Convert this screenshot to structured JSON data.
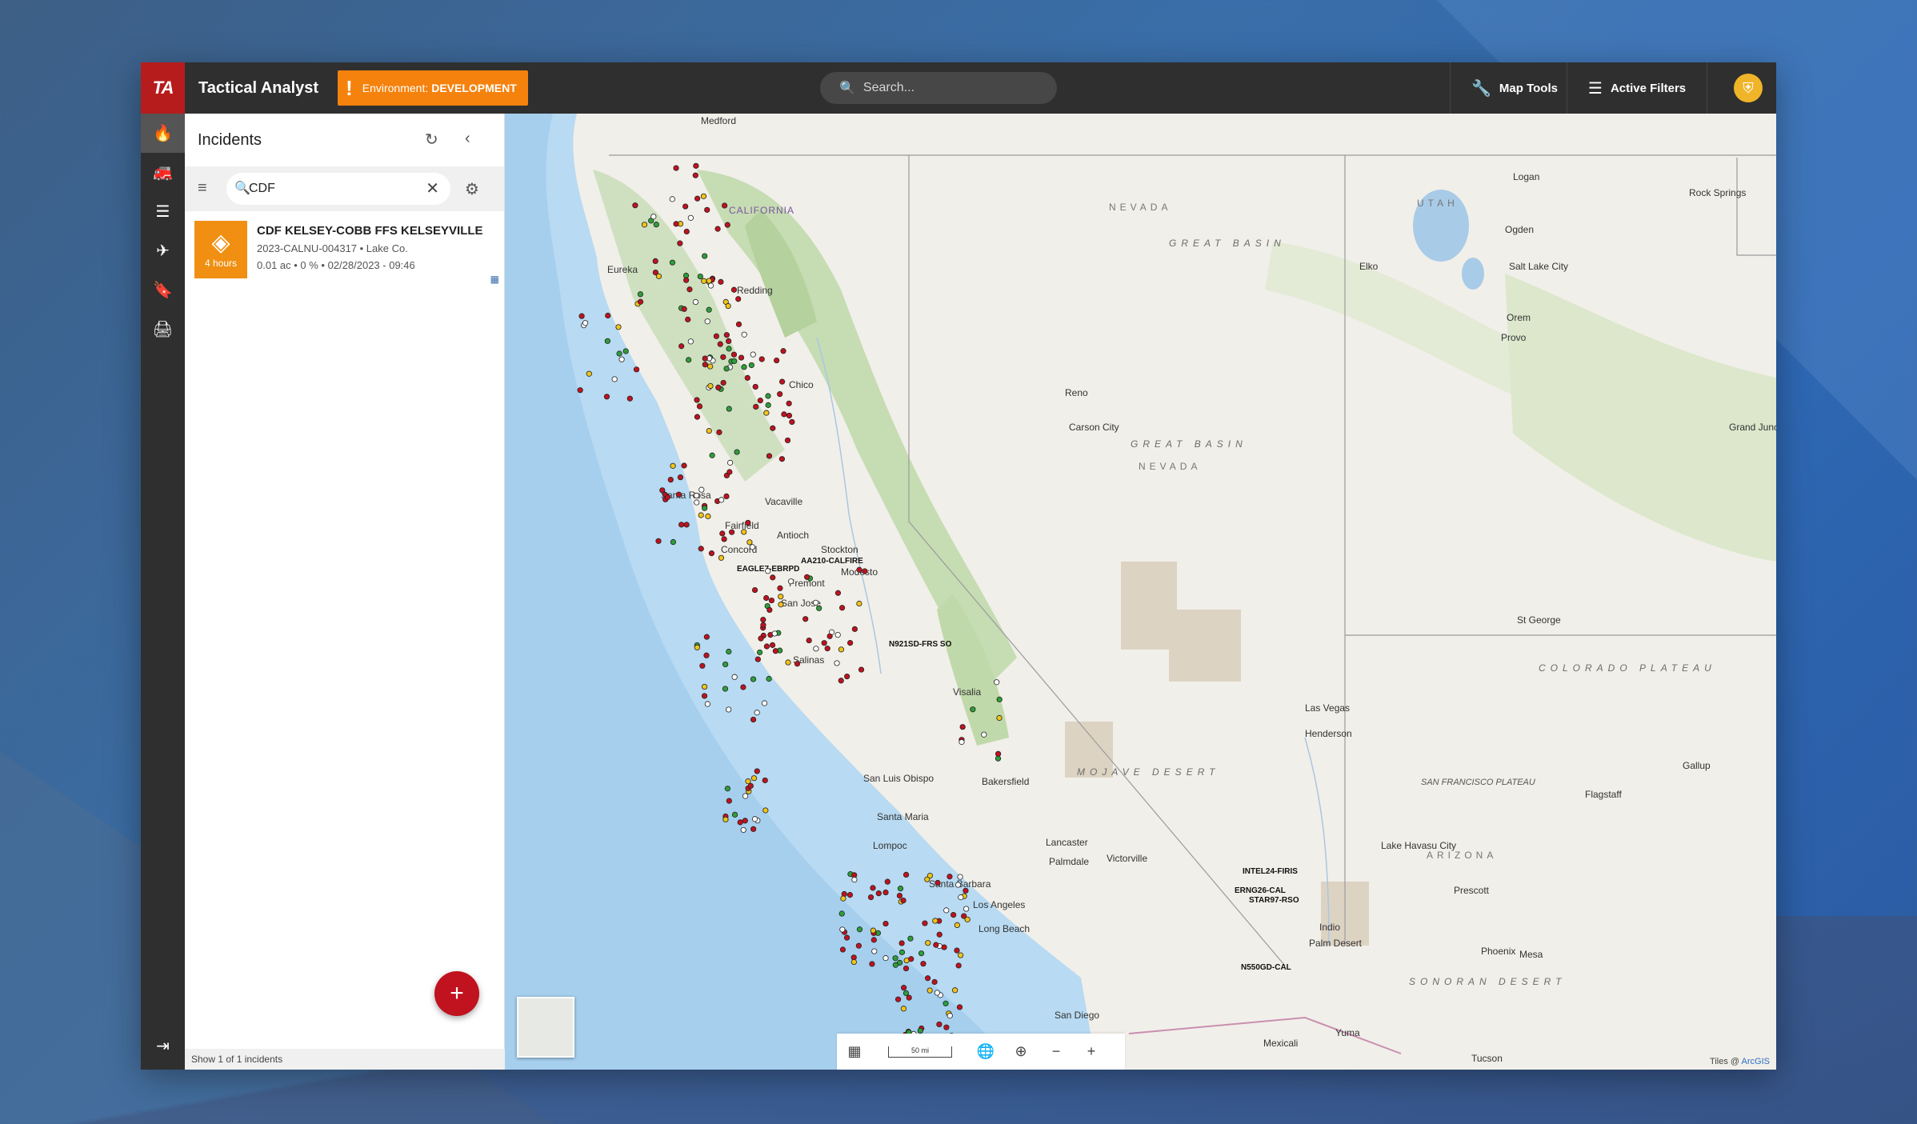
{
  "header": {
    "logo": "TA",
    "title": "Tactical Analyst",
    "env_prefix": "Environment:",
    "env_value": "DEVELOPMENT",
    "search_placeholder": "Search...",
    "map_tools_label": "Map Tools",
    "active_filters_label": "Active Filters"
  },
  "rail": {
    "items": [
      "flame-icon",
      "engine-icon",
      "layers-icon",
      "aircraft-icon",
      "bookmark-icon",
      "print-icon"
    ],
    "bottom": "expand-icon"
  },
  "panel": {
    "title": "Incidents",
    "filter_value": "CDF",
    "incident": {
      "name": "CDF KELSEY-COBB FFS KELSEYVILLE",
      "id_county": "2023-CALNU-004317 • Lake Co.",
      "stats": "0.01 ac • 0 % • 02/28/2023 - 09:46",
      "age": "4 hours"
    },
    "footer": "Show 1 of 1 incidents",
    "accent": "#f08f12"
  },
  "map": {
    "scale_label": "50 mi",
    "attribution_prefix": "Tiles @",
    "attribution_link": "ArcGIS",
    "state_labels": [
      "NEVADA",
      "UTAH",
      "CALIFORNIA",
      "ARIZONA",
      "NEVADA"
    ],
    "region_labels": [
      "GREAT BASIN",
      "GREAT BASIN",
      "COLORADO PLATEAU",
      "MOJAVE DESERT",
      "SONORAN DESERT",
      "SAN FRANCISCO PLATEAU"
    ],
    "cities": [
      "Medford",
      "Eureka",
      "Redding",
      "Chico",
      "Reno",
      "Carson City",
      "Elko",
      "Logan",
      "Ogden",
      "Salt Lake City",
      "Orem",
      "Provo",
      "Rock Springs",
      "Grand Junction",
      "Santa Rosa",
      "Vacaville",
      "Fairfield",
      "Antioch",
      "Concord",
      "Stockton",
      "Modesto",
      "Fremont",
      "San Jose",
      "Salinas",
      "Visalia",
      "Bakersfield",
      "San Luis Obispo",
      "Santa Maria",
      "Lompoc",
      "Santa Barbara",
      "Los Angeles",
      "Long Beach",
      "Lancaster",
      "Palmdale",
      "Victorville",
      "San Diego",
      "Mexicali",
      "Yuma",
      "Tucson",
      "Phoenix",
      "Mesa",
      "Prescott",
      "Flagstaff",
      "Gallup",
      "Las Vegas",
      "Henderson",
      "St George",
      "Lake Havasu City",
      "Indio",
      "Palm Desert"
    ],
    "callsigns": [
      "N921SD-FRS SO",
      "AA210-CALFIRE",
      "EAGLE7-EBRPD",
      "INTEL24-FIRIS",
      "STAR97-RSO",
      "N550GD-CAL",
      "ERNG26-CAL"
    ]
  }
}
